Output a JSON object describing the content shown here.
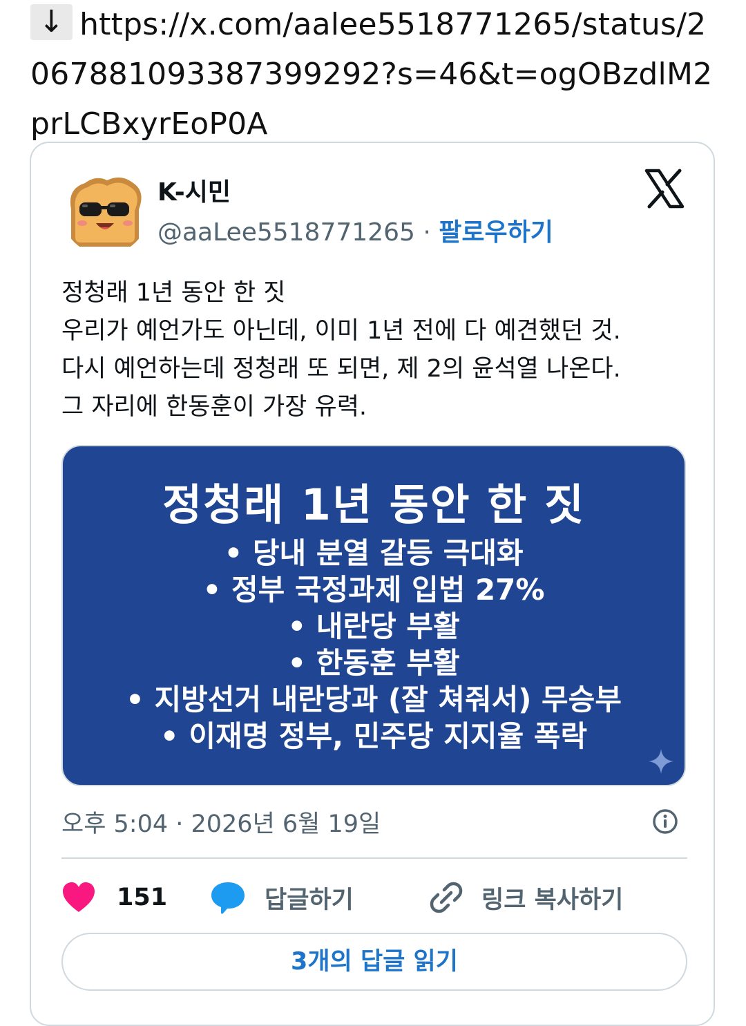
{
  "url_bar": {
    "arrow": "↓",
    "url": "https://x.com/aalee5518771265/status/2067881093387399292?s=46&t=ogOBzdlM2prLCBxyrEoP0A"
  },
  "tweet": {
    "display_name": "K-시민",
    "handle": "@aaLee5518771265",
    "separator": " · ",
    "follow_label": "팔로우하기",
    "avatar_icon": "toast-with-sunglasses-avatar",
    "brand_icon": "x-logo-icon",
    "text_lines": [
      "정청래 1년 동안 한 짓",
      "우리가 예언가도 아닌데, 이미 1년 전에 다 예견했던 것.",
      "다시 예언하는데 정청래 또 되면,  제 2의 윤석열 나온다.",
      "그 자리에 한동훈이 가장 유력."
    ],
    "media": {
      "title": "정청래 1년 동안 한 짓",
      "items": [
        "• 당내 분열 갈등 극대화",
        "• 정부 국정과제 입법 27%",
        "• 내란당 부활",
        "• 한동훈 부활",
        "• 지방선거 내란당과 (잘 쳐줘서) 무승부",
        "• 이재명 정부, 민주당 지지율 폭락"
      ],
      "background_color": "#1f4593"
    },
    "timestamp": "오후 5:04 · 2026년 6월 19일",
    "likes_count": "151",
    "reply_label": "답글하기",
    "copy_link_label": "링크 복사하기",
    "read_replies_label": "3개의 답글 읽기"
  },
  "colors": {
    "accent_blue": "#1d74c9",
    "like_pink": "#f91880",
    "reply_blue": "#1d9bf0",
    "muted_text": "#536471",
    "border": "#cfd9de"
  }
}
